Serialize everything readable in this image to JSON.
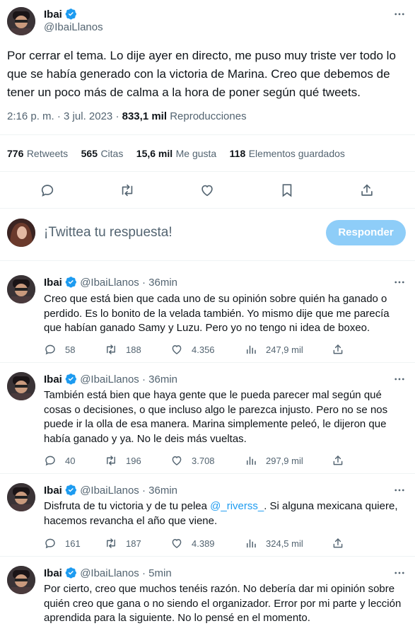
{
  "main_tweet": {
    "name": "Ibai",
    "handle": "@IbaiLlanos",
    "text": "Por cerrar el tema. Lo dije ayer en directo, me puso muy triste ver todo lo que se había generado con la victoria de Marina. Creo que debemos de tener un poco más de calma a la hora de poner según qué tweets.",
    "time": "2:16 p. m.",
    "dot": "·",
    "date": "3 jul. 2023",
    "views_count": "833,1 mil",
    "views_label": "Reproducciones",
    "stats": [
      {
        "count": "776",
        "label": "Retweets"
      },
      {
        "count": "565",
        "label": "Citas"
      },
      {
        "count": "15,6 mil",
        "label": "Me gusta"
      },
      {
        "count": "118",
        "label": "Elementos guardados"
      }
    ],
    "more_icon": "more-horizontal-icon"
  },
  "composer": {
    "placeholder": "¡Twittea tu respuesta!",
    "button_label": "Responder"
  },
  "replies": [
    {
      "name": "Ibai",
      "handle": "@IbaiLlanos",
      "dot": "·",
      "time": "36min",
      "text": "Creo que está bien que cada uno de su opinión sobre quién ha ganado o perdido. Es lo bonito de la velada también. Yo mismo dije que me parecía que habían ganado Samy y Luzu. Pero yo no tengo ni idea de boxeo.",
      "replies": "58",
      "retweets": "188",
      "likes": "4.356",
      "views": "247,9 mil"
    },
    {
      "name": "Ibai",
      "handle": "@IbaiLlanos",
      "dot": "·",
      "time": "36min",
      "text": "También está bien que haya gente que le pueda parecer mal según qué cosas o decisiones, o que incluso algo le parezca injusto. Pero no se nos puede ir la olla de esa manera. Marina simplemente peleó, le dijeron que había ganado y ya. No le deis más vueltas.",
      "replies": "40",
      "retweets": "196",
      "likes": "3.708",
      "views": "297,9 mil"
    },
    {
      "name": "Ibai",
      "handle": "@IbaiLlanos",
      "dot": "·",
      "time": "36min",
      "text_before": "Disfruta de tu victoria y de tu pelea ",
      "mention": "@_riverss_",
      "text_after": ". Si alguna mexicana quiere, hacemos revancha el año que viene.",
      "replies": "161",
      "retweets": "187",
      "likes": "4.389",
      "views": "324,5 mil"
    },
    {
      "name": "Ibai",
      "handle": "@IbaiLlanos",
      "dot": "·",
      "time": "5min",
      "text": "Por cierto, creo que muchos tenéis razón. No debería dar mi opinión sobre quién creo que gana o no siendo el organizador. Error por mi parte y lección aprendida para la siguiente. No lo pensé en el momento."
    }
  ],
  "colors": {
    "accent": "#1d9bf0",
    "button_disabled": "#8ecdf8",
    "muted": "#536471",
    "border": "#eff3f4"
  }
}
